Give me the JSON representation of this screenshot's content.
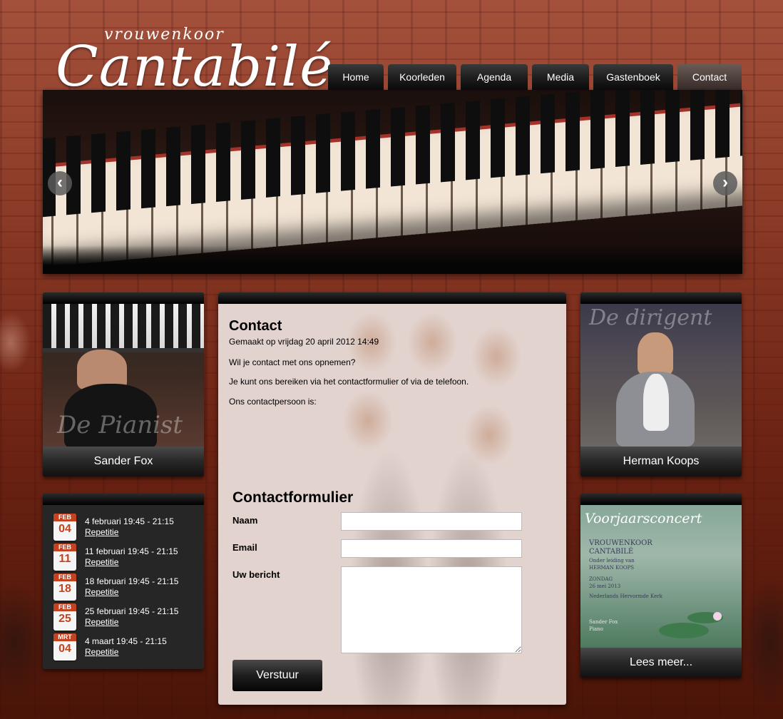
{
  "logo": {
    "small": "vrouwenkoor",
    "big": "Cantabilé"
  },
  "nav": {
    "items": [
      {
        "label": "Home"
      },
      {
        "label": "Koorleden"
      },
      {
        "label": "Agenda"
      },
      {
        "label": "Media"
      },
      {
        "label": "Gastenboek"
      },
      {
        "label": "Contact",
        "active": true
      }
    ]
  },
  "slider": {
    "prev": "‹",
    "next": "›"
  },
  "sidebar_left": {
    "pianist": {
      "watermark": "De Pianist",
      "name": "Sander Fox"
    },
    "agenda": [
      {
        "month": "FEB",
        "day": "04",
        "time": "4 februari 19:45 - 21:15",
        "title": "Repetitie"
      },
      {
        "month": "FEB",
        "day": "11",
        "time": "11 februari 19:45 - 21:15",
        "title": "Repetitie"
      },
      {
        "month": "FEB",
        "day": "18",
        "time": "18 februari 19:45 - 21:15",
        "title": "Repetitie"
      },
      {
        "month": "FEB",
        "day": "25",
        "time": "25 februari 19:45 - 21:15",
        "title": "Repetitie"
      },
      {
        "month": "MRT",
        "day": "04",
        "time": "4 maart 19:45 - 21:15",
        "title": "Repetitie"
      }
    ]
  },
  "sidebar_right": {
    "conductor": {
      "watermark": "De dirigent",
      "name": "Herman Koops"
    },
    "poster": {
      "title": "Voorjaarsconcert",
      "line1": "VROUWENKOOR",
      "line2": "CANTABILÉ",
      "line3": "Onder leiding van",
      "line4": "HERMAN KOOPS",
      "line5": "ZONDAG",
      "line6": "26 mei 2013",
      "line7": "Nederlands Hervormde Kerk",
      "line8": "Sander Fox",
      "line9": "Piano",
      "caption": "Lees meer..."
    }
  },
  "content": {
    "title": "Contact",
    "meta": "Gemaakt op vrijdag 20 april 2012 14:49",
    "p1": "Wil je contact met ons opnemen?",
    "p2": "Je kunt ons bereiken via het contactformulier of via de telefoon.",
    "p3": "Ons contactpersoon is:",
    "form": {
      "title": "Contactformulier",
      "name_label": "Naam",
      "name_value": "",
      "email_label": "Email",
      "email_value": "",
      "message_label": "Uw bericht",
      "message_value": "",
      "submit_label": "Verstuur"
    }
  }
}
